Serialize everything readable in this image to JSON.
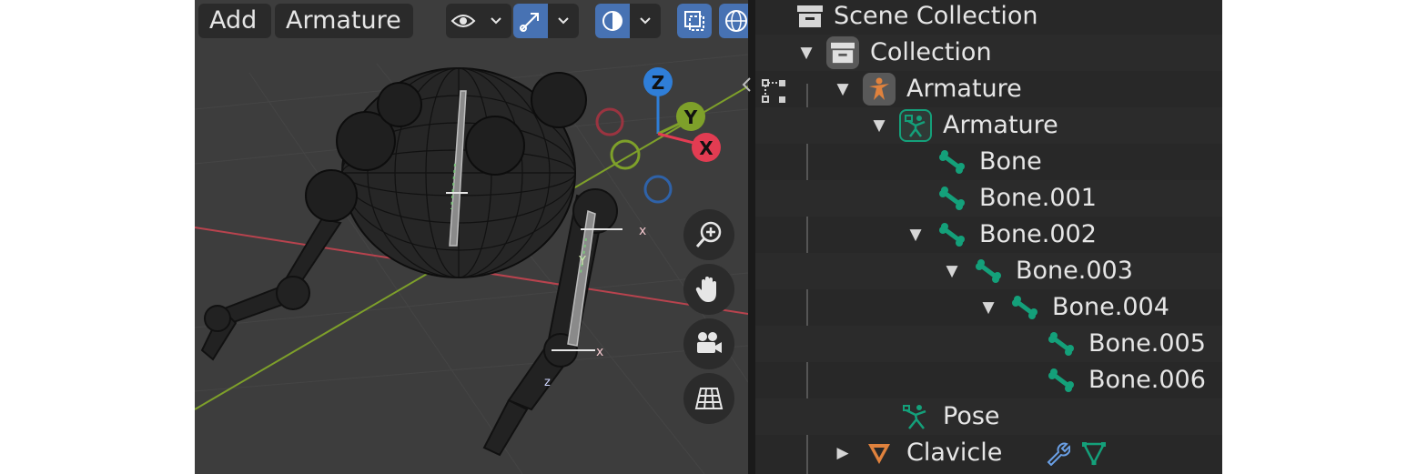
{
  "viewport": {
    "header": {
      "add_label": "Add",
      "armature_label": "Armature",
      "view_icon": "eye-icon",
      "gizmo_icon": "transform-gizmo-icon",
      "overlay_icon": "overlay-icon",
      "xray_icon": "xray-icon",
      "shading_icon": "wireframe-sphere-icon"
    },
    "gizmo": {
      "z": "Z",
      "y": "Y",
      "x": "X"
    },
    "marker_x": "x",
    "marker_y": "Y",
    "marker_z": "z",
    "nav_buttons": [
      "zoom-icon",
      "hand-pan-icon",
      "camera-icon",
      "grid-ortho-icon"
    ]
  },
  "outliner": {
    "rows": [
      {
        "label": "Scene Collection",
        "icon": "collection-icon",
        "expanded": null
      },
      {
        "label": "Collection",
        "icon": "collection-icon",
        "expanded": true
      },
      {
        "label": "Armature",
        "icon": "armature-object-icon",
        "expanded": true
      },
      {
        "label": "Armature",
        "icon": "armature-data-icon",
        "expanded": true
      },
      {
        "label": "Bone",
        "icon": "bone-icon",
        "expanded": null
      },
      {
        "label": "Bone.001",
        "icon": "bone-icon",
        "expanded": null
      },
      {
        "label": "Bone.002",
        "icon": "bone-icon",
        "expanded": true
      },
      {
        "label": "Bone.003",
        "icon": "bone-icon",
        "expanded": true
      },
      {
        "label": "Bone.004",
        "icon": "bone-icon",
        "expanded": true
      },
      {
        "label": "Bone.005",
        "icon": "bone-icon",
        "expanded": null
      },
      {
        "label": "Bone.006",
        "icon": "bone-icon",
        "expanded": null
      },
      {
        "label": "Pose",
        "icon": "pose-icon",
        "expanded": null
      },
      {
        "label": "Clavicle",
        "icon": "mesh-object-icon",
        "expanded": false,
        "extra_icons": [
          "wrench-icon",
          "mesh-data-icon"
        ]
      }
    ]
  },
  "colors": {
    "bone_green": "#14a07a",
    "armature_orange": "#e0823d",
    "accent_blue": "#4772b3",
    "axis_x": "#e23c52",
    "axis_y": "#7ea02a",
    "axis_z": "#2f7ed8"
  }
}
